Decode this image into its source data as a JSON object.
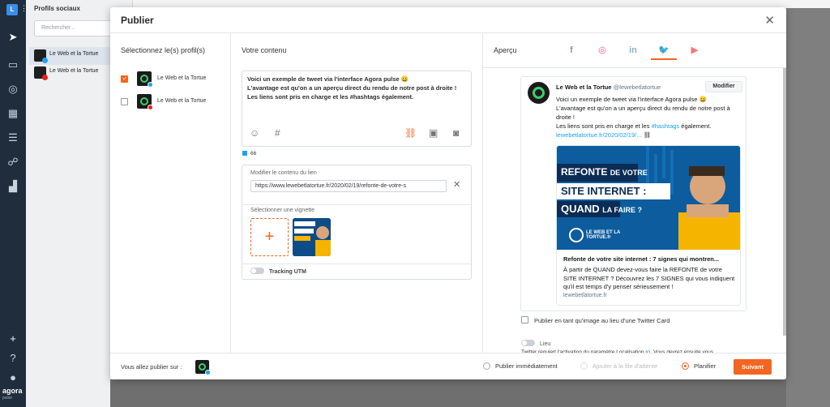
{
  "app": {
    "avatar_letter": "L",
    "brand": "agora",
    "brand_sub": "pulse",
    "panel_title": "Profils sociaux",
    "search_placeholder": "Rechercher...",
    "profiles": [
      {
        "name": "Le Web et la Tortue",
        "network": "twitter"
      },
      {
        "name": "Le Web et la Tortue",
        "network": "youtube"
      }
    ]
  },
  "modal": {
    "title": "Publier",
    "col1_title": "Sélectionnez le(s) profil(s)",
    "col2_title": "Votre contenu",
    "col3_title": "Aperçu",
    "profiles": [
      {
        "name": "Le Web et la Tortue",
        "checked": true,
        "network": "twitter"
      },
      {
        "name": "Le Web et la Tortue",
        "checked": false,
        "network": "youtube"
      }
    ],
    "content": {
      "line1": "Voici un exemple de tweet via l'interface Agora pulse 😀",
      "line2": "L'avantage est qu'on a un aperçu direct du rendu de notre post à droite !",
      "line3": "Les liens  sont pris en charge et les #hashtags également.",
      "char_count": "66"
    },
    "link": {
      "label": "Modifier le contenu du lien",
      "url": "https://www.lewebetlatortue.fr/2020/02/19/refonte-de-votre-s",
      "thumb_label": "Sélectionner une vignette",
      "utm_label": "Tracking UTM"
    },
    "preview": {
      "tabs": [
        "facebook",
        "instagram",
        "linkedin",
        "twitter",
        "youtube"
      ],
      "active_tab": "twitter",
      "name": "Le Web et la Tortue",
      "handle": "@lewebetlatortue",
      "modify_label": "Modifier",
      "body_line1": "Voici un exemple de tweet via l'interface Agora pulse 😀",
      "body_line2": "L'avantage est qu'on a un aperçu direct du rendu de notre post à droite !",
      "body_line3a": "Les liens  sont pris en charge et les ",
      "body_hashtag": "#hashtags",
      "body_line3b": " également.",
      "body_link": "lewebetlatortue.fr/2020/02/19/...",
      "card_img_line1": "REFONTE",
      "card_img_line1b": "DE VOTRE",
      "card_img_line2": "SITE INTERNET :",
      "card_img_line3": "QUAND",
      "card_img_line3b": "LA FAIRE ?",
      "card_img_logo": "LE WEB ET LA TORTUE.fr",
      "card_title": "Refonte de votre site internet : 7 signes qui montren...",
      "card_desc": "À partir de QUAND devez-vous faire la REFONTE de votre SITE INTERNET ? Découvrez les 7 SIGNES qui vous indiquent qu'il est temps d'y penser sérieusement !",
      "card_domain": "lewebetlatortue.fr",
      "image_option": "Publier en tant qu'image au lieu d'une Twitter Card",
      "lieu_label": "Lieu",
      "lieu_note": "Twitter requiert l'activation du paramètre Localisation ",
      "lieu_link": "ici",
      "lieu_note2": ". Vous devrez ensuite vous"
    },
    "footer": {
      "publish_on": "Vous allez publier sur :",
      "options": [
        "Publier immédiatement",
        "Ajouter à la file d'attente",
        "Planifier"
      ],
      "selected_option": "Planifier",
      "submit": "Suivant"
    }
  },
  "colors": {
    "accent": "#f26522",
    "twitter": "#1da1f2",
    "rail": "#1f2d3d"
  }
}
